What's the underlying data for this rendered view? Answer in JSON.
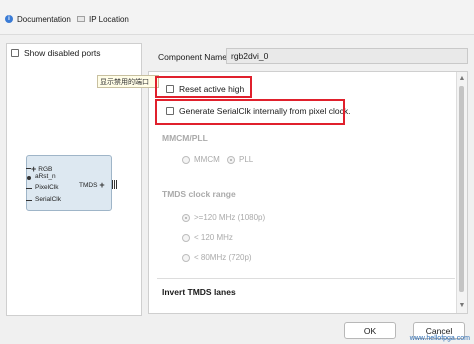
{
  "toolbar": {
    "documentation_label": "Documentation",
    "ip_location_label": "IP Location"
  },
  "left": {
    "show_disabled_ports_label": "Show disabled ports",
    "tooltip_text": "显示禁用的端口",
    "block": {
      "left_ports": [
        "RGB",
        "aRst_n",
        "PixelClk",
        "SerialClk"
      ],
      "right_port": "TMDS"
    }
  },
  "component": {
    "label": "Component Name",
    "value": "rgb2dvi_0"
  },
  "options": {
    "reset_active_high": "Reset active high",
    "generate_serialclk": "Generate SerialClk internally from pixel clock."
  },
  "mmcm": {
    "title": "MMCM/PLL",
    "mmcm_label": "MMCM",
    "pll_label": "PLL",
    "selected": "PLL"
  },
  "tmds_range": {
    "title": "TMDS clock range",
    "options": [
      ">=120 MHz (1080p)",
      "< 120 MHz",
      "< 80MHz (720p)"
    ]
  },
  "invert": {
    "title": "Invert TMDS lanes"
  },
  "buttons": {
    "ok": "OK",
    "cancel": "Cancel"
  },
  "watermark": "www.hellofpga.com",
  "colors": {
    "highlight": "#e0202c",
    "block_fill": "#dde8f1",
    "disabled_text": "#aaaaaa"
  }
}
